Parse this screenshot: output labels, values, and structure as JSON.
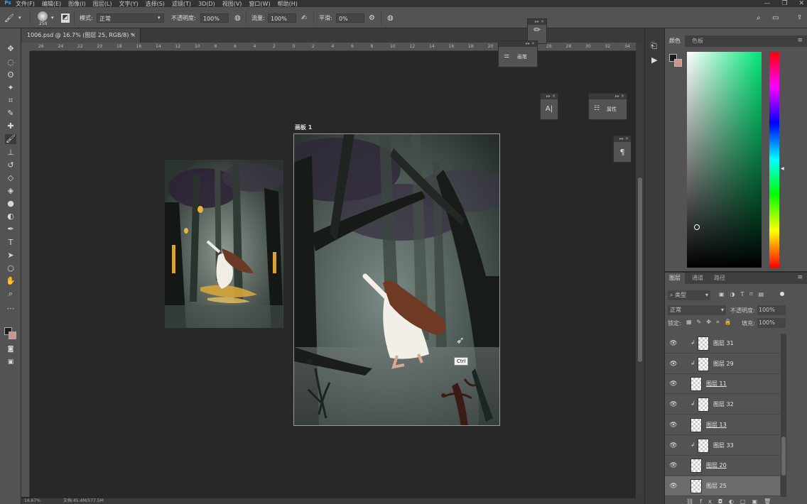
{
  "menu": {
    "logo": "Ps",
    "items": [
      "文件(F)",
      "编辑(E)",
      "图像(I)",
      "图层(L)",
      "文字(Y)",
      "选择(S)",
      "滤镜(T)",
      "3D(D)",
      "视图(V)",
      "窗口(W)",
      "帮助(H)"
    ],
    "window_controls": [
      "—",
      "❐",
      "✕"
    ]
  },
  "options": {
    "brush_size": "250",
    "mode_label": "模式:",
    "mode_value": "正常",
    "opacity_label": "不透明度:",
    "opacity_value": "100%",
    "flow_label": "流量:",
    "flow_value": "100%",
    "smoothing_label": "平滑:",
    "smoothing_value": "0%"
  },
  "document": {
    "tab_title": "1006.psd @ 16.7% (图层 25, RGB/8) *",
    "artboard_label": "画板 1",
    "zoom": "16.67%",
    "doc_info": "文档:45.4M/577.5M",
    "cursor_hint": "Ctrl"
  },
  "ruler_ticks": [
    "26",
    "24",
    "22",
    "20",
    "18",
    "16",
    "14",
    "12",
    "10",
    "8",
    "6",
    "4",
    "2",
    "0",
    "2",
    "4",
    "6",
    "8",
    "10",
    "12",
    "14",
    "16",
    "18",
    "20",
    "22",
    "24",
    "26",
    "28",
    "30",
    "32",
    "34"
  ],
  "floating_panels": {
    "brush_panel_label": "画笔",
    "properties_label": "属性",
    "character_icon": "A|",
    "paragraph_icon": "¶"
  },
  "color_panel": {
    "tabs": [
      "颜色",
      "色板"
    ],
    "hue_color": "#00e676"
  },
  "layers_panel": {
    "tabs": [
      "图层",
      "通道",
      "路径"
    ],
    "filter_label": "类型",
    "blend_mode": "正常",
    "opacity_label": "不透明度:",
    "opacity_value": "100%",
    "lock_label": "锁定:",
    "fill_label": "填充:",
    "fill_value": "100%",
    "layers": [
      {
        "name": "图层 31",
        "clipped": true,
        "underline": false,
        "selected": false
      },
      {
        "name": "图层 29",
        "clipped": true,
        "underline": false,
        "selected": false
      },
      {
        "name": "图层 11",
        "clipped": false,
        "underline": true,
        "selected": false
      },
      {
        "name": "图层 32",
        "clipped": true,
        "underline": false,
        "selected": false
      },
      {
        "name": "图层 13",
        "clipped": false,
        "underline": true,
        "selected": false
      },
      {
        "name": "图层 33",
        "clipped": true,
        "underline": false,
        "selected": false
      },
      {
        "name": "图层 20",
        "clipped": false,
        "underline": true,
        "selected": false
      },
      {
        "name": "图层 25",
        "clipped": false,
        "underline": false,
        "selected": true
      }
    ]
  }
}
